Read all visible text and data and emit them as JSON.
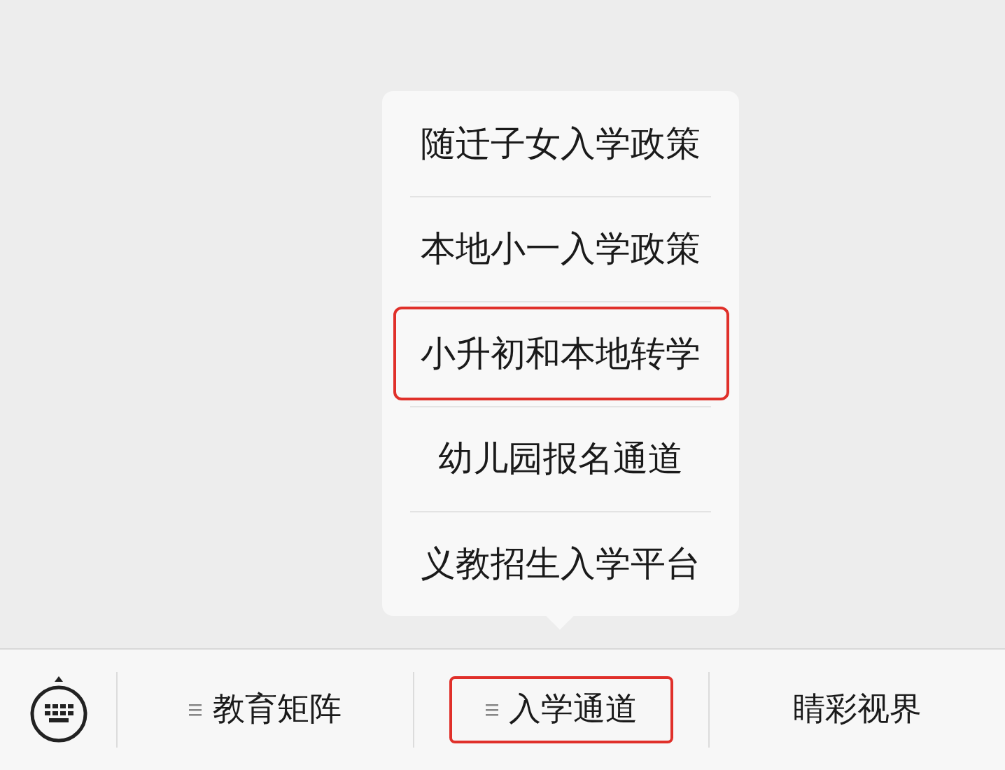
{
  "menu": {
    "items": [
      {
        "label": "随迁子女入学政策",
        "highlighted": false
      },
      {
        "label": "本地小一入学政策",
        "highlighted": false
      },
      {
        "label": "小升初和本地转学",
        "highlighted": true
      },
      {
        "label": "幼儿园报名通道",
        "highlighted": false
      },
      {
        "label": "义教招生入学平台",
        "highlighted": false
      }
    ]
  },
  "bottom_bar": {
    "tabs": [
      {
        "label": "教育矩阵",
        "has_submenu": true,
        "highlighted": false
      },
      {
        "label": "入学通道",
        "has_submenu": true,
        "highlighted": true
      },
      {
        "label": "睛彩视界",
        "has_submenu": false,
        "highlighted": false
      }
    ]
  }
}
